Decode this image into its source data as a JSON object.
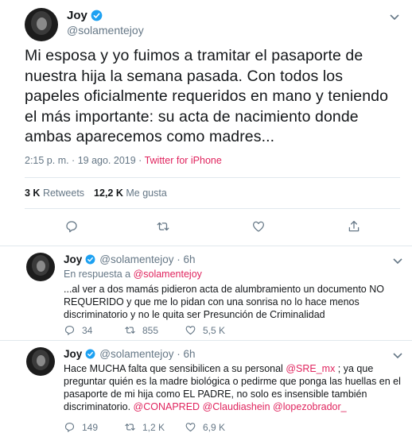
{
  "main_tweet": {
    "display_name": "Joy",
    "handle": "@solamentejoy",
    "text": "Mi esposa y yo fuimos a tramitar el pasaporte de nuestra hija la semana pasada. Con todos los papeles oficialmente requeridos en mano y teniendo el más importante: su acta de nacimiento donde ambas aparecemos como madres...",
    "timestamp": "2:15 p. m. · 19 ago. 2019 · ",
    "source": "Twitter for iPhone",
    "retweets_count": "3 K",
    "retweets_label": "Retweets",
    "likes_count": "12,2 K",
    "likes_label": "Me gusta",
    "actions": {
      "reply_icon": "comment-icon",
      "retweet_icon": "retweet-icon",
      "like_icon": "heart-icon",
      "share_icon": "share-icon"
    }
  },
  "replies": [
    {
      "display_name": "Joy",
      "handle_time": "@solamentejoy · 6h",
      "reply_to_prefix": "En respuesta a ",
      "reply_to_handle": "@solamentejoy",
      "text": "...al ver a dos mamás pidieron acta de alumbramiento un documento NO REQUERIDO y que me lo pidan con una sonrisa no lo hace menos discriminatorio y no le quita ser Presunción de Criminalidad",
      "reply_count": "34",
      "retweet_count": "855",
      "like_count": "5,5 K"
    },
    {
      "display_name": "Joy",
      "handle_time": "@solamentejoy · 6h",
      "text_part1": "Hace MUCHA falta que sensibilicen a su personal ",
      "mention1": "@SRE_mx",
      "text_part2": " ; ya que preguntar quién es la madre biológica o pedirme que ponga las huellas en el pasaporte de mi hija como EL PADRE, no solo es insensible también discriminatorio. ",
      "mention2": "@CONAPRED",
      "mention3": "@Claudiashein",
      "mention4": "@lopezobrador_",
      "reply_count": "149",
      "retweet_count": "1,2 K",
      "like_count": "6,9 K"
    }
  ],
  "colors": {
    "accent": "#1da1f2",
    "secondary_text": "#657786",
    "mention": "#e0245e",
    "divider": "#e1e8ed"
  }
}
